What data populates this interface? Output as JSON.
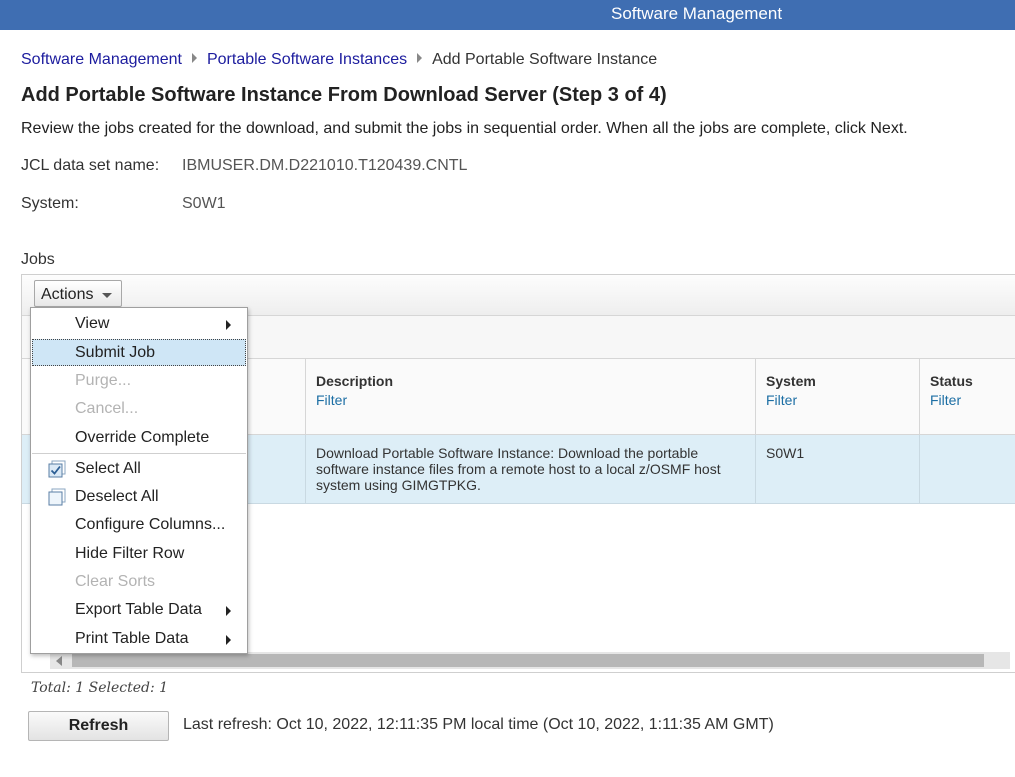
{
  "topbar": {
    "title": "Software Management"
  },
  "breadcrumb": {
    "items": [
      "Software Management",
      "Portable Software Instances"
    ],
    "current": "Add Portable Software Instance"
  },
  "page": {
    "title": "Add Portable Software Instance From Download Server (Step 3 of 4)",
    "intro": "Review the jobs created for the download, and submit the jobs in sequential order. When all the jobs are complete, click Next."
  },
  "details": {
    "jcl_label": "JCL data set name:",
    "jcl_value": "IBMUSER.DM.D221010.T120439.CNTL",
    "system_label": "System:",
    "system_value": "S0W1"
  },
  "jobs": {
    "section_label": "Jobs",
    "actions_label": "Actions",
    "columns": [
      {
        "name": "Description",
        "filter": "Filter"
      },
      {
        "name": "System",
        "filter": "Filter"
      },
      {
        "name": "Status",
        "filter": "Filter"
      }
    ],
    "rows": [
      {
        "description": "Download Portable Software Instance:  Download the portable software instance files from a remote host to a local z/OSMF host system using GIMGTPKG.",
        "system": "S0W1",
        "status": ""
      }
    ],
    "summary": "Total: 1 Selected: 1"
  },
  "menu": {
    "items": [
      {
        "label": "View",
        "submenu": true,
        "enabled": true
      },
      {
        "label": "Submit Job",
        "enabled": true,
        "highlighted": true
      },
      {
        "label": "Purge...",
        "enabled": false
      },
      {
        "label": "Cancel...",
        "enabled": false
      },
      {
        "label": "Override Complete",
        "enabled": true
      },
      {
        "label": "Select All",
        "enabled": true,
        "icon": "select-all-icon"
      },
      {
        "label": "Deselect All",
        "enabled": true,
        "icon": "deselect-all-icon"
      },
      {
        "label": "Configure Columns...",
        "enabled": true
      },
      {
        "label": "Hide Filter Row",
        "enabled": true
      },
      {
        "label": "Clear Sorts",
        "enabled": false
      },
      {
        "label": "Export Table Data",
        "submenu": true,
        "enabled": true
      },
      {
        "label": "Print Table Data",
        "submenu": true,
        "enabled": true
      }
    ]
  },
  "footer": {
    "refresh_label": "Refresh",
    "last_refresh": "Last refresh: Oct 10, 2022, 12:11:35 PM local time (Oct 10, 2022, 1:11:35 AM GMT)"
  },
  "colors": {
    "topbar": "#3f6eb2",
    "link": "#1c1c9e",
    "selected_row": "#ddeef7",
    "menu_highlight": "#cfe6f6"
  }
}
